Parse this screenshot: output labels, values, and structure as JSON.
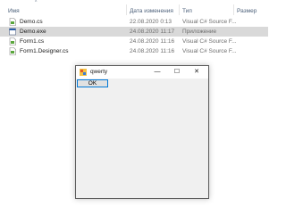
{
  "explorer": {
    "columns": {
      "name": "Имя",
      "date": "Дата изменения",
      "type": "Тип",
      "size": "Размер"
    },
    "sort_indicator": "^",
    "files": [
      {
        "name": "Demo.cs",
        "date": "22.08.2020 0:13",
        "type": "Visual C# Source F...",
        "icon": "csharp-file-icon",
        "selected": false
      },
      {
        "name": "Demo.exe",
        "date": "24.08.2020 11:17",
        "type": "Приложение",
        "icon": "exe-file-icon",
        "selected": true
      },
      {
        "name": "Form1.cs",
        "date": "24.08.2020 11:16",
        "type": "Visual C# Source F...",
        "icon": "csharp-file-icon",
        "selected": false
      },
      {
        "name": "Form1.Designer.cs",
        "date": "24.08.2020 11:16",
        "type": "Visual C# Source F...",
        "icon": "csharp-file-icon",
        "selected": false
      }
    ]
  },
  "window": {
    "title": "qwerty",
    "icon": "app-icon",
    "controls": {
      "minimize": "—",
      "maximize": "☐",
      "close": "✕"
    },
    "ok_button_label": "OK"
  },
  "colors": {
    "selection": "#d9d9d9",
    "button_border": "#0078d7",
    "window_bg": "#f0f0f0"
  }
}
